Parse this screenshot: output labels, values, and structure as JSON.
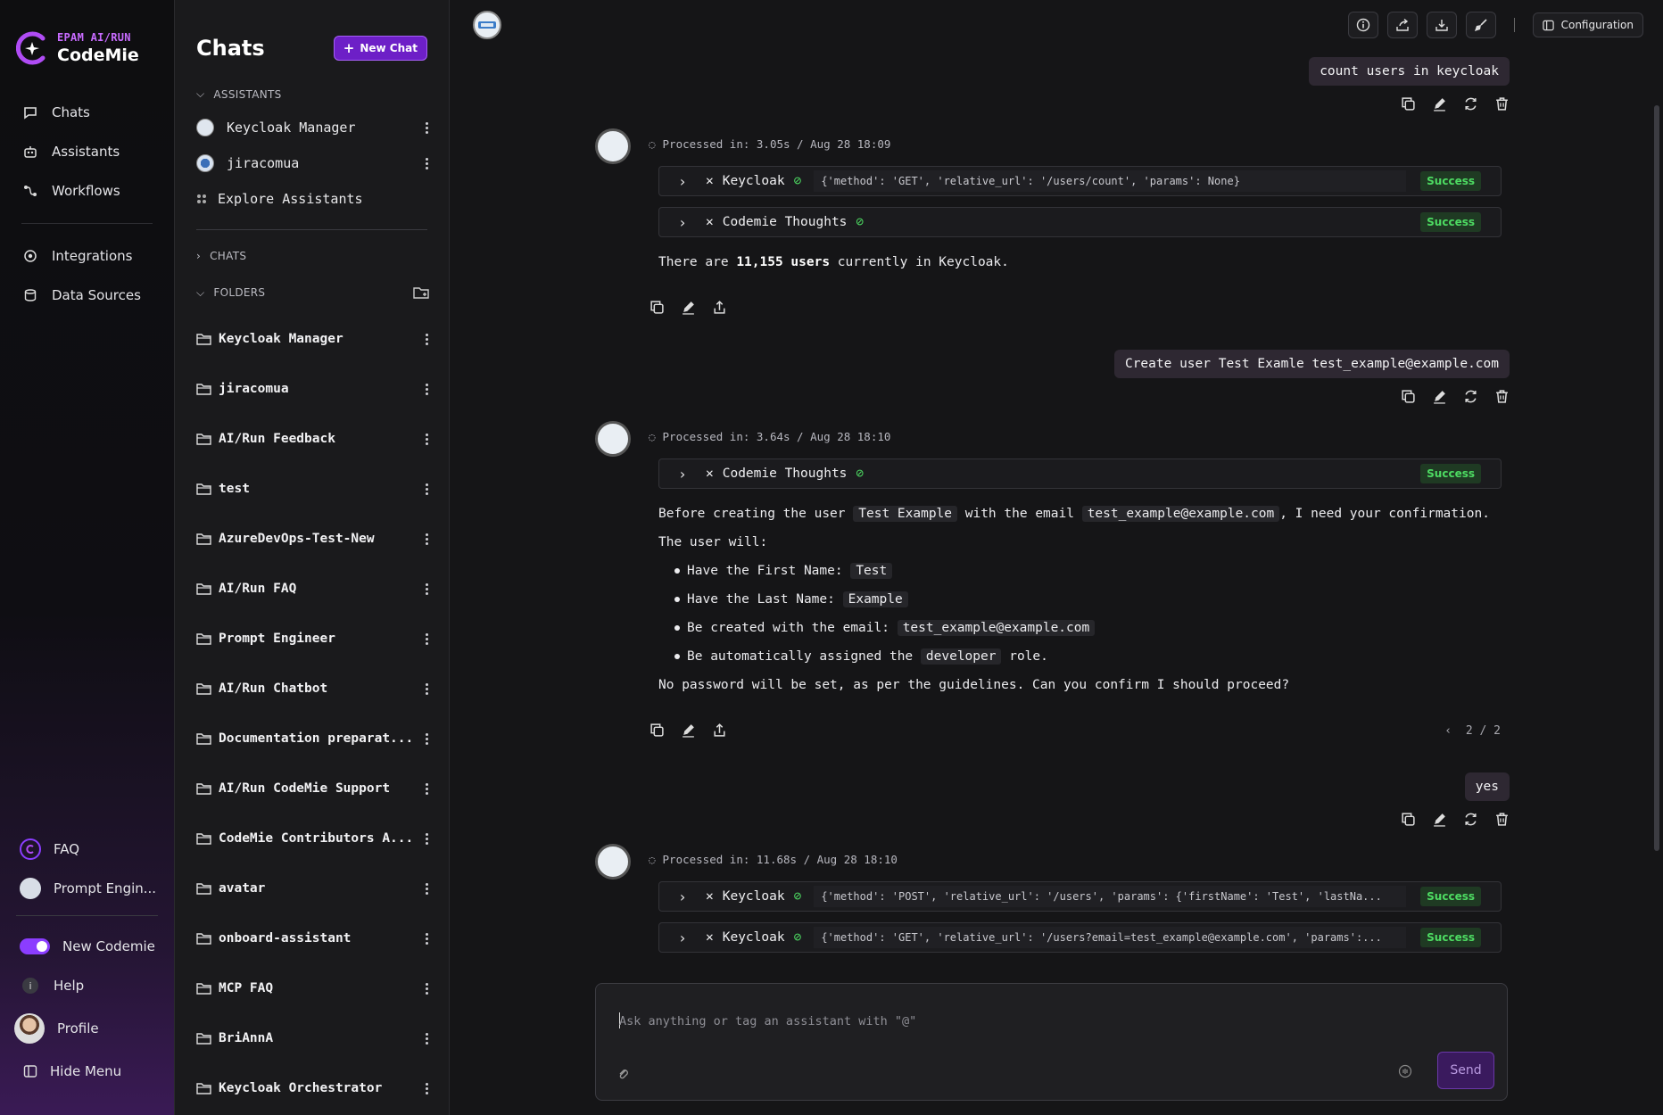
{
  "brand": {
    "small": "EPAM AI/RUN",
    "name": "CodeMie"
  },
  "leftnav": {
    "items": [
      {
        "label": "Chats",
        "icon": "chat-icon"
      },
      {
        "label": "Assistants",
        "icon": "robot-icon"
      },
      {
        "label": "Workflows",
        "icon": "workflow-icon"
      },
      {
        "label": "Integrations",
        "icon": "integrations-icon"
      },
      {
        "label": "Data Sources",
        "icon": "database-icon"
      }
    ],
    "bottom": {
      "faq": "FAQ",
      "prompt": "Prompt Engin...",
      "new_codemie": "New Codemie",
      "help": "Help",
      "profile": "Profile",
      "hide_menu": "Hide Menu"
    }
  },
  "chats_panel": {
    "title": "Chats",
    "new_chat": "New Chat",
    "assistants_label": "ASSISTANTS",
    "assistants": [
      {
        "name": "Keycloak Manager"
      },
      {
        "name": "jiracomua"
      }
    ],
    "explore": "Explore Assistants",
    "chats_label": "CHATS",
    "folders_label": "FOLDERS",
    "folders": [
      "Keycloak Manager",
      "jiracomua",
      "AI/Run Feedback",
      "test",
      "AzureDevOps-Test-New",
      "AI/Run FAQ",
      "Prompt Engineer",
      "AI/Run Chatbot",
      "Documentation preparat...",
      "AI/Run CodeMie Support",
      "CodeMie Contributors A...",
      "avatar",
      "onboard-assistant",
      "MCP FAQ",
      "BriAnnA",
      "Keycloak Orchestrator"
    ]
  },
  "topbar": {
    "configuration": "Configuration"
  },
  "conversation": {
    "msg1_user": "count users in keycloak",
    "msg1_processed": "Processed in: 3.05s / Aug 28 18:09",
    "msg1_tool1_name": "Keycloak",
    "msg1_tool1_params": "{'method': 'GET', 'relative_url': '/users/count', 'params': None}",
    "msg1_tool2_name": "Codemie Thoughts",
    "status": "Success",
    "msg1_text_a": "There are ",
    "msg1_text_b": "11,155 users",
    "msg1_text_c": " currently in Keycloak.",
    "msg2_user": "Create user Test Examle test_example@example.com",
    "msg2_processed": "Processed in: 3.64s / Aug 28 18:10",
    "msg2_tool_name": "Codemie Thoughts",
    "msg2_p1_a": "Before creating the user ",
    "msg2_p1_code1": "Test Example",
    "msg2_p1_b": " with the email ",
    "msg2_p1_code2": "test_example@example.com",
    "msg2_p1_c": ", I need your confirmation.",
    "msg2_p2": "The user will:",
    "msg2_list": [
      {
        "text": "Have the First Name: ",
        "code": "Test",
        "after": ""
      },
      {
        "text": "Have the Last Name: ",
        "code": "Example",
        "after": ""
      },
      {
        "text": "Be created with the email: ",
        "code": "test_example@example.com",
        "after": ""
      },
      {
        "text": "Be automatically assigned the ",
        "code": "developer",
        "after": " role."
      }
    ],
    "msg2_p3": "No password will be set, as per the guidelines. Can you confirm I should proceed?",
    "msg2_pager": "2 / 2",
    "msg3_user": "yes",
    "msg3_processed": "Processed in: 11.68s / Aug 28 18:10",
    "msg3_tool1_name": "Keycloak",
    "msg3_tool1_params": "{'method': 'POST', 'relative_url': '/users', 'params': {'firstName': 'Test', 'lastNa...",
    "msg3_tool2_name": "Keycloak",
    "msg3_tool2_params": "{'method': 'GET', 'relative_url': '/users?email=test_example@example.com', 'params':..."
  },
  "composer": {
    "placeholder": "Ask anything or tag an assistant with \"@\"",
    "send": "Send"
  },
  "colors": {
    "accent": "#8b3dff",
    "success_text": "#4ddb62",
    "success_bg": "#1f3a23"
  }
}
